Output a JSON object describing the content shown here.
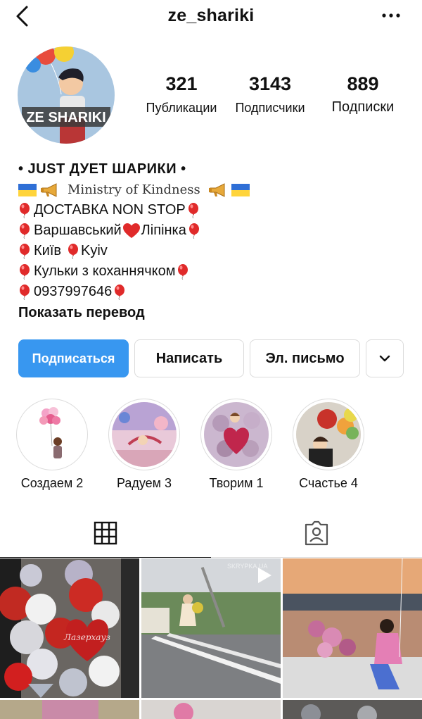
{
  "header": {
    "username": "ze_shariki",
    "back_icon": "chevron-left-icon",
    "more_icon": "ellipsis-icon"
  },
  "profile": {
    "avatar_text": "ZE SHARIKI",
    "stats": [
      {
        "value": "321",
        "label": "Публикации"
      },
      {
        "value": "3143",
        "label": "Подписчики"
      },
      {
        "value": "889",
        "label": "Подписки"
      }
    ]
  },
  "bio": {
    "title": "• JUST ДУЕТ ШАРИКИ •",
    "ministry": "Ministry of Kindness",
    "delivery": "ДОСТАВКА NON STOP",
    "address_a": "Варшавський",
    "address_b": "Ліпінка",
    "city_a": "Київ",
    "city_b": "Kyiv",
    "kulky": "Кульки з коханнячком",
    "phone": "0937997646",
    "translate": "Показать перевод"
  },
  "actions": {
    "follow": "Подписаться",
    "message": "Написать",
    "email": "Эл. письмо"
  },
  "highlights": [
    {
      "label": "Создаем 2"
    },
    {
      "label": "Радуем 3"
    },
    {
      "label": "Творим 1"
    },
    {
      "label": "Счастье 4"
    }
  ],
  "tabs": {
    "grid_icon": "grid-icon",
    "tagged_icon": "tagged-person-icon"
  },
  "posts": {
    "post1_text": "Лазерхауз",
    "post2_watermark": "SKRYPKA.UA"
  },
  "colors": {
    "accent": "#3897f0",
    "border": "#dbdbdb",
    "balloon_red": "#e02a2a"
  }
}
